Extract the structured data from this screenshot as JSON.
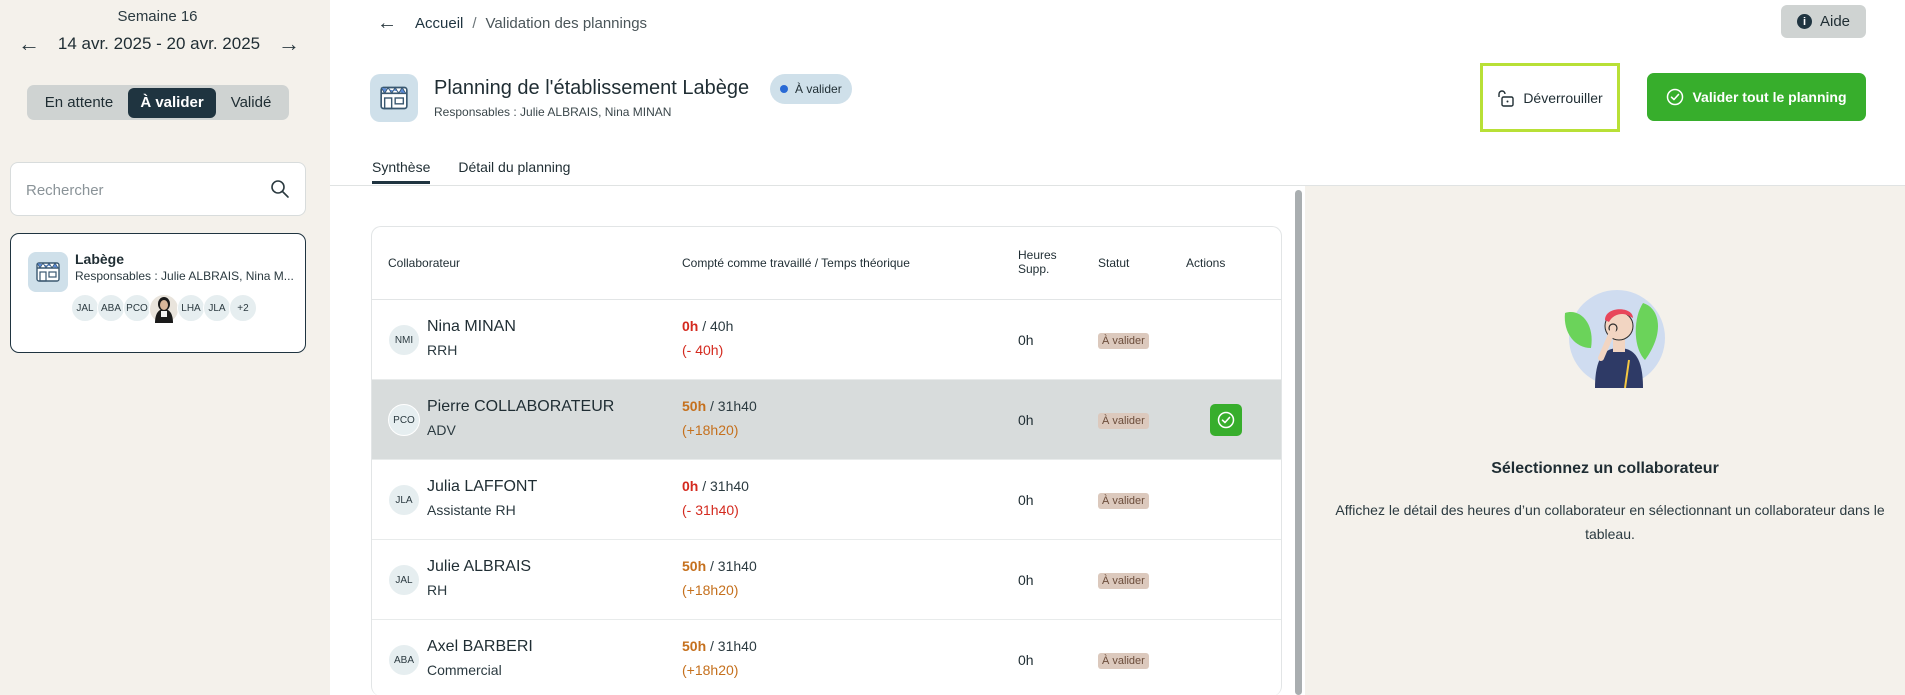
{
  "sidebar": {
    "week_label": "Semaine 16",
    "week_range": "14 avr. 2025 - 20 avr. 2025",
    "prev_arrow": "←",
    "next_arrow": "→",
    "segments": [
      "En attente",
      "À valider",
      "Validé"
    ],
    "active_segment": "À valider",
    "search_placeholder": "Rechercher",
    "card": {
      "title": "Labège",
      "responsables": "Responsables : Julie ALBRAIS, Nina M...",
      "avatars": [
        "JAL",
        "ABA",
        "PCO",
        "",
        "LHA",
        "JLA",
        "+2"
      ]
    }
  },
  "topbar": {
    "back_arrow": "←",
    "breadcrumb_home": "Accueil",
    "breadcrumb_sep": "/",
    "breadcrumb_current": "Validation des plannings",
    "help_label": "Aide",
    "help_icon": "i"
  },
  "header": {
    "title": "Planning de l'établissement Labège",
    "responsables": "Responsables : Julie ALBRAIS, Nina MINAN",
    "status": "À valider",
    "unlock_label": "Déverrouiller",
    "validate_label": "Valider tout le planning"
  },
  "tabs": [
    "Synthèse",
    "Détail du planning"
  ],
  "table": {
    "headers": {
      "collaborateur": "Collaborateur",
      "compte": "Compté comme travaillé / Temps théorique",
      "heures_line1": "Heures",
      "heures_line2": "Supp.",
      "statut": "Statut",
      "actions": "Actions"
    },
    "rows": [
      {
        "initials": "NMI",
        "name": "Nina MINAN",
        "job": "RRH",
        "worked": "0h",
        "theoretical": " / 40h",
        "diff": "(- 40h)",
        "tone": "red",
        "overtime": "0h",
        "status": "À valider",
        "selected": false
      },
      {
        "initials": "PCO",
        "name": "Pierre COLLABORATEUR",
        "job": "ADV",
        "worked": "50h",
        "theoretical": " / 31h40",
        "diff": "(+18h20)",
        "tone": "orange",
        "overtime": "0h",
        "status": "À valider",
        "selected": true
      },
      {
        "initials": "JLA",
        "name": "Julia LAFFONT",
        "job": "Assistante RH",
        "worked": "0h",
        "theoretical": " / 31h40",
        "diff": "(- 31h40)",
        "tone": "red",
        "overtime": "0h",
        "status": "À valider",
        "selected": false
      },
      {
        "initials": "JAL",
        "name": "Julie ALBRAIS",
        "job": "RH",
        "worked": "50h",
        "theoretical": " / 31h40",
        "diff": "(+18h20)",
        "tone": "orange",
        "overtime": "0h",
        "status": "À valider",
        "selected": false
      },
      {
        "initials": "ABA",
        "name": "Axel BARBERI",
        "job": "Commercial",
        "worked": "50h",
        "theoretical": " / 31h40",
        "diff": "(+18h20)",
        "tone": "orange",
        "overtime": "0h",
        "status": "À valider",
        "selected": false
      }
    ]
  },
  "right_panel": {
    "title": "Sélectionnez un collaborateur",
    "text": "Affichez le détail des heures d’un collaborateur en sélectionnant un collaborateur dans le tableau."
  },
  "colors": {
    "accent_dark": "#1f3440",
    "green": "#37ae2c",
    "red": "#d42a1f",
    "orange": "#c5701d",
    "highlight": "#b8e036"
  }
}
